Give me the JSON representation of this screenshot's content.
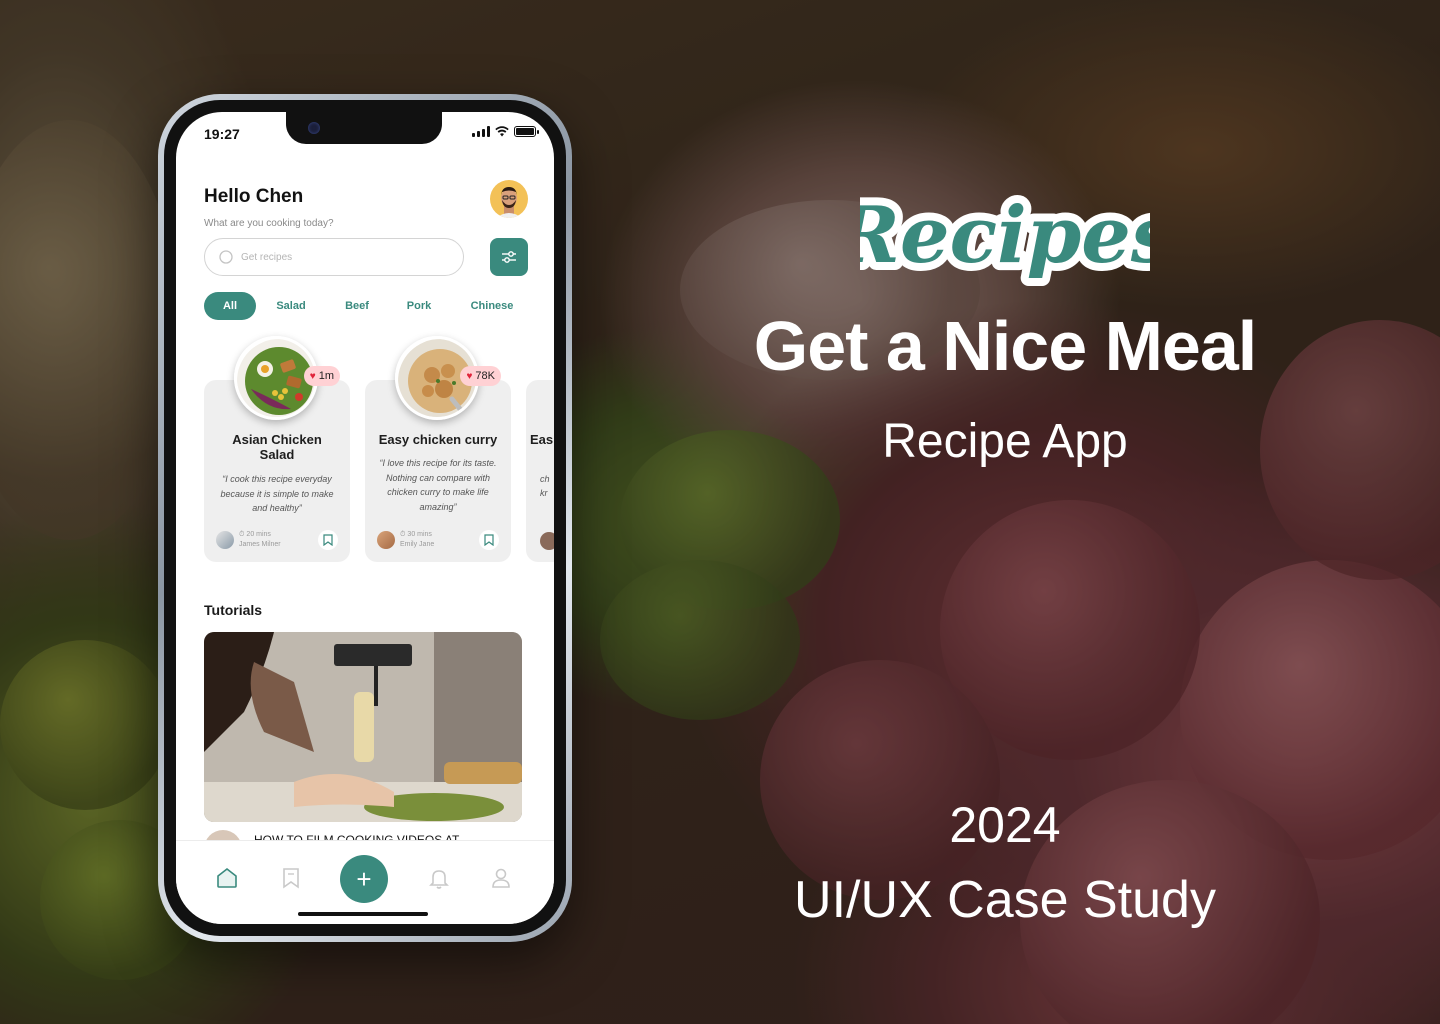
{
  "colors": {
    "accent": "#3a8a7e",
    "like_badge": "#ffd1d4",
    "heart": "#e0243b",
    "avatar_bg": "#f3c157"
  },
  "hero": {
    "logo_text": "Recipes",
    "title": "Get a Nice Meal",
    "subtitle": "Recipe App",
    "year": "2024",
    "case_study": "UI/UX Case Study"
  },
  "phone": {
    "status_time": "19:27",
    "greeting": "Hello Chen",
    "greeting_sub": "What are you cooking today?",
    "search": {
      "placeholder": "Get recipes",
      "value": ""
    },
    "categories": [
      {
        "label": "All",
        "active": true
      },
      {
        "label": "Salad",
        "active": false
      },
      {
        "label": "Beef",
        "active": false
      },
      {
        "label": "Pork",
        "active": false
      },
      {
        "label": "Chinese",
        "active": false
      }
    ],
    "recipes": [
      {
        "likes": "1m",
        "title": "Asian Chicken Salad",
        "quote": "“I cook this recipe everyday because it is simple to make and healthy”",
        "time": "20 mins",
        "author": "James Milner"
      },
      {
        "likes": "78K",
        "title": "Easy chicken curry",
        "quote": "“I love this recipe for its taste. Nothing can compare with chicken curry to make life amazing”",
        "time": "30 mins",
        "author": "Emily Jane"
      },
      {
        "title_partial": "Eas",
        "quote_partial_1": "ch",
        "quote_partial_2": "kr"
      }
    ],
    "tutorials_heading": "Tutorials",
    "tutorial": {
      "title": "HOW TO FILM COOKING VIDEOS AT"
    },
    "tabbar": {
      "items": [
        "home-icon",
        "bookmark-icon",
        "plus-icon",
        "bell-icon",
        "user-icon"
      ],
      "add_symbol": "+"
    }
  }
}
